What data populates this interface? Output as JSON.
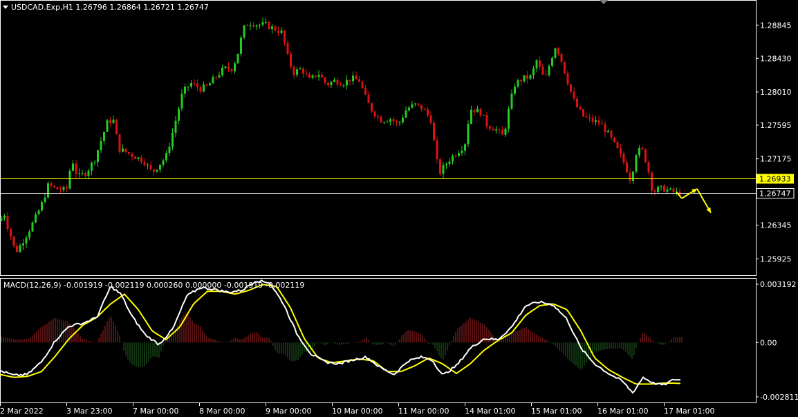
{
  "header": {
    "symbol_info": "USDCAD.Exp,H1  1.26796 1.26864 1.26721 1.26747"
  },
  "macd": {
    "info": "MACD(12,26,9) -0.001919 -0.002119 0.000260 0.000000 -0.001919 -0.002119",
    "axis_labels": [
      "0.003192",
      "0.00",
      "-0.002811"
    ]
  },
  "price_axis": {
    "labels": [
      "1.28845",
      "1.28430",
      "1.28010",
      "1.27595",
      "1.27175",
      "1.26345",
      "1.25925"
    ],
    "h_line": {
      "value": "1.26933",
      "color": "#ffff00"
    },
    "bid_line": {
      "value": "1.26747",
      "color": "#ffffff"
    }
  },
  "time_axis": {
    "labels": [
      "2 Mar 2022",
      "3 Mar 23:00",
      "7 Mar 00:00",
      "8 Mar 00:00",
      "9 Mar 00:00",
      "10 Mar 00:00",
      "11 Mar 00:00",
      "14 Mar 01:00",
      "15 Mar 01:00",
      "16 Mar 01:00",
      "17 Mar 01:00"
    ]
  },
  "colors": {
    "bull": "#22cc22",
    "bear": "#dd1111",
    "macd_line": "#ffffff",
    "signal_line": "#ffff00",
    "hist_pos": "#aa2222",
    "hist_neg": "#226622",
    "arrow": "#ffff00",
    "frame": "#ffffff"
  },
  "chart_data": {
    "type": "candlestick",
    "price_path": [
      [
        0,
        1.264
      ],
      [
        6,
        1.265
      ],
      [
        12,
        1.263
      ],
      [
        18,
        1.2615
      ],
      [
        22,
        1.26
      ],
      [
        30,
        1.261
      ],
      [
        40,
        1.2625
      ],
      [
        52,
        1.2645
      ],
      [
        60,
        1.266
      ],
      [
        70,
        1.2685
      ],
      [
        80,
        1.268
      ],
      [
        96,
        1.2678
      ],
      [
        104,
        1.2718
      ],
      [
        112,
        1.2695
      ],
      [
        124,
        1.27
      ],
      [
        136,
        1.2715
      ],
      [
        148,
        1.2745
      ],
      [
        156,
        1.2765
      ],
      [
        164,
        1.2765
      ],
      [
        172,
        1.273
      ],
      [
        184,
        1.2725
      ],
      [
        196,
        1.272
      ],
      [
        208,
        1.2715
      ],
      [
        220,
        1.27
      ],
      [
        232,
        1.2712
      ],
      [
        240,
        1.272
      ],
      [
        248,
        1.2745
      ],
      [
        256,
        1.2772
      ],
      [
        264,
        1.28
      ],
      [
        276,
        1.2812
      ],
      [
        290,
        1.2805
      ],
      [
        300,
        1.2808
      ],
      [
        312,
        1.282
      ],
      [
        324,
        1.283
      ],
      [
        336,
        1.283
      ],
      [
        344,
        1.285
      ],
      [
        352,
        1.288
      ],
      [
        360,
        1.2888
      ],
      [
        372,
        1.2885
      ],
      [
        384,
        1.2885
      ],
      [
        396,
        1.288
      ],
      [
        408,
        1.2875
      ],
      [
        416,
        1.2845
      ],
      [
        424,
        1.2825
      ],
      [
        436,
        1.283
      ],
      [
        448,
        1.2815
      ],
      [
        460,
        1.2825
      ],
      [
        472,
        1.281
      ],
      [
        484,
        1.2815
      ],
      [
        496,
        1.2812
      ],
      [
        508,
        1.2818
      ],
      [
        520,
        1.2815
      ],
      [
        528,
        1.2795
      ],
      [
        536,
        1.278
      ],
      [
        544,
        1.2772
      ],
      [
        552,
        1.2765
      ],
      [
        564,
        1.2768
      ],
      [
        576,
        1.276
      ],
      [
        588,
        1.278
      ],
      [
        600,
        1.2785
      ],
      [
        612,
        1.278
      ],
      [
        624,
        1.2765
      ],
      [
        630,
        1.272
      ],
      [
        636,
        1.27
      ],
      [
        648,
        1.2715
      ],
      [
        660,
        1.2725
      ],
      [
        672,
        1.2735
      ],
      [
        680,
        1.278
      ],
      [
        688,
        1.2778
      ],
      [
        696,
        1.2775
      ],
      [
        704,
        1.276
      ],
      [
        716,
        1.2755
      ],
      [
        728,
        1.2745
      ],
      [
        736,
        1.278
      ],
      [
        744,
        1.281
      ],
      [
        756,
        1.2818
      ],
      [
        768,
        1.282
      ],
      [
        776,
        1.284
      ],
      [
        788,
        1.2815
      ],
      [
        796,
        1.284
      ],
      [
        804,
        1.286
      ],
      [
        812,
        1.284
      ],
      [
        824,
        1.2805
      ],
      [
        832,
        1.2785
      ],
      [
        844,
        1.277
      ],
      [
        856,
        1.2765
      ],
      [
        868,
        1.2762
      ],
      [
        880,
        1.2748
      ],
      [
        892,
        1.273
      ],
      [
        904,
        1.271
      ],
      [
        912,
        1.269
      ],
      [
        920,
        1.2725
      ],
      [
        928,
        1.273
      ],
      [
        936,
        1.271
      ],
      [
        944,
        1.2675
      ],
      [
        952,
        1.268
      ],
      [
        960,
        1.268
      ],
      [
        970,
        1.2677
      ],
      [
        980,
        1.2674
      ],
      [
        986,
        1.2675
      ]
    ],
    "forecast_arrows": [
      [
        986,
        1.2668
      ],
      [
        1008,
        1.268
      ],
      [
        1028,
        1.265
      ]
    ],
    "ylim_price": [
      1.2572,
      1.2915
    ],
    "macd_path": [
      [
        0,
        -0.00145
      ],
      [
        20,
        -0.0017
      ],
      [
        40,
        -0.00165
      ],
      [
        60,
        -0.001
      ],
      [
        80,
        0.0001
      ],
      [
        100,
        0.00085
      ],
      [
        120,
        0.001
      ],
      [
        140,
        0.0013
      ],
      [
        160,
        0.0029
      ],
      [
        175,
        0.0025
      ],
      [
        190,
        0.0014
      ],
      [
        210,
        0.0004
      ],
      [
        230,
        -0.0001
      ],
      [
        250,
        0.0007
      ],
      [
        270,
        0.0024
      ],
      [
        290,
        0.00285
      ],
      [
        310,
        0.00275
      ],
      [
        330,
        0.0026
      ],
      [
        350,
        0.0027
      ],
      [
        370,
        0.0032
      ],
      [
        390,
        0.0031
      ],
      [
        410,
        0.002
      ],
      [
        430,
        0.0004
      ],
      [
        450,
        -0.0006
      ],
      [
        470,
        -0.001
      ],
      [
        490,
        -0.0011
      ],
      [
        510,
        -0.0009
      ],
      [
        530,
        -0.00075
      ],
      [
        550,
        -0.0013
      ],
      [
        570,
        -0.00165
      ],
      [
        590,
        -0.00095
      ],
      [
        610,
        -0.00075
      ],
      [
        625,
        -0.0009
      ],
      [
        640,
        -0.0017
      ],
      [
        660,
        -0.0012
      ],
      [
        680,
        -0.0003
      ],
      [
        700,
        0.0002
      ],
      [
        720,
        0.00015
      ],
      [
        740,
        0.0008
      ],
      [
        760,
        0.0019
      ],
      [
        780,
        0.0021
      ],
      [
        800,
        0.00195
      ],
      [
        820,
        0.0012
      ],
      [
        840,
        -0.0003
      ],
      [
        860,
        -0.0011
      ],
      [
        880,
        -0.0016
      ],
      [
        900,
        -0.002
      ],
      [
        915,
        -0.0026
      ],
      [
        930,
        -0.0018
      ],
      [
        945,
        -0.0021
      ],
      [
        960,
        -0.0022
      ],
      [
        975,
        -0.0019
      ],
      [
        986,
        -0.00195
      ]
    ],
    "signal_path": [
      [
        0,
        -0.00165
      ],
      [
        20,
        -0.0018
      ],
      [
        40,
        -0.00175
      ],
      [
        60,
        -0.0015
      ],
      [
        80,
        -0.0007
      ],
      [
        100,
        0.0002
      ],
      [
        120,
        0.0009
      ],
      [
        140,
        0.0013
      ],
      [
        160,
        0.002
      ],
      [
        180,
        0.0025
      ],
      [
        200,
        0.0017
      ],
      [
        220,
        0.0006
      ],
      [
        240,
        0.00015
      ],
      [
        260,
        0.0008
      ],
      [
        280,
        0.002
      ],
      [
        300,
        0.00265
      ],
      [
        320,
        0.00265
      ],
      [
        340,
        0.0025
      ],
      [
        360,
        0.0027
      ],
      [
        380,
        0.003
      ],
      [
        400,
        0.0029
      ],
      [
        420,
        0.0018
      ],
      [
        440,
        0.0002
      ],
      [
        460,
        -0.0008
      ],
      [
        480,
        -0.00105
      ],
      [
        500,
        -0.00095
      ],
      [
        520,
        -0.00085
      ],
      [
        540,
        -0.00095
      ],
      [
        560,
        -0.0015
      ],
      [
        580,
        -0.0015
      ],
      [
        600,
        -0.0012
      ],
      [
        620,
        -0.0008
      ],
      [
        640,
        -0.0011
      ],
      [
        660,
        -0.0016
      ],
      [
        680,
        -0.0011
      ],
      [
        700,
        -0.0004
      ],
      [
        720,
        0.0001
      ],
      [
        740,
        0.0005
      ],
      [
        760,
        0.0014
      ],
      [
        780,
        0.0019
      ],
      [
        800,
        0.002
      ],
      [
        820,
        0.0017
      ],
      [
        840,
        0.0006
      ],
      [
        860,
        -0.0008
      ],
      [
        880,
        -0.0014
      ],
      [
        900,
        -0.0018
      ],
      [
        920,
        -0.00215
      ],
      [
        940,
        -0.00215
      ],
      [
        960,
        -0.0021
      ],
      [
        975,
        -0.0021
      ],
      [
        986,
        -0.00212
      ]
    ],
    "ylim_macd": [
      -0.0031,
      0.0033
    ]
  }
}
